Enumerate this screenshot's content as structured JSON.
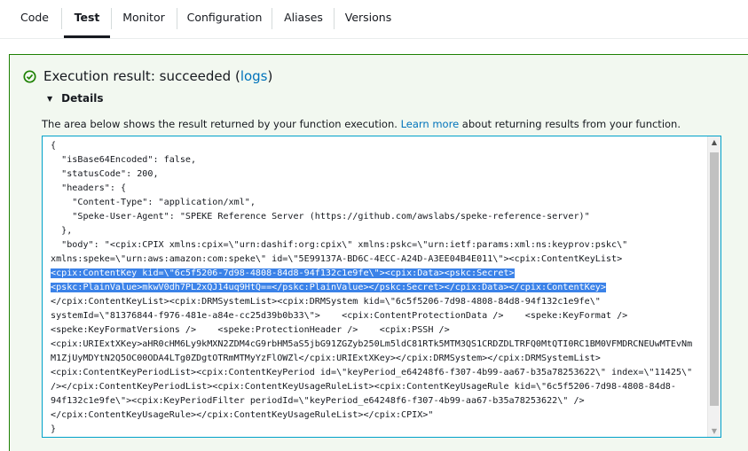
{
  "tabs": [
    {
      "label": "Code",
      "active": false
    },
    {
      "label": "Test",
      "active": true
    },
    {
      "label": "Monitor",
      "active": false
    },
    {
      "label": "Configuration",
      "active": false
    },
    {
      "label": "Aliases",
      "active": false
    },
    {
      "label": "Versions",
      "active": false
    }
  ],
  "result": {
    "status_prefix": "Execution result: succeeded (",
    "logs_link": "logs",
    "status_suffix": ")",
    "status_icon": "check-circle-icon",
    "status_color": "#1d8102"
  },
  "details": {
    "label": "Details",
    "icon": "triangle-down-icon",
    "description_before": "The area below shows the result returned by your function execution. ",
    "learn_more": "Learn more",
    "description_after": " about returning results from your function."
  },
  "output": {
    "lines": [
      "{",
      "  \"isBase64Encoded\": false,",
      "  \"statusCode\": 200,",
      "  \"headers\": {",
      "    \"Content-Type\": \"application/xml\",",
      "    \"Speke-User-Agent\": \"SPEKE Reference Server (https://github.com/awslabs/speke-reference-server)\"",
      "  },",
      "  \"body\": \"<cpix:CPIX xmlns:cpix=\\\"urn:dashif:org:cpix\\\" xmlns:pskc=\\\"urn:ietf:params:xml:ns:keyprov:pskc\\\"",
      "xmlns:speke=\\\"urn:aws:amazon:com:speke\\\" id=\\\"5E99137A-BD6C-4ECC-A24D-A3EE04B4E011\\\"><cpix:ContentKeyList>",
      "<cpix:ContentKey kid=\\\"6c5f5206-7d98-4808-84d8-94f132c1e9fe\\\"><cpix:Data><pskc:Secret>",
      "<pskc:PlainValue>mkwV0dh7PL2xQJ14uq9HtQ==</pskc:PlainValue></pskc:Secret></cpix:Data></cpix:ContentKey>",
      "</cpix:ContentKeyList><cpix:DRMSystemList><cpix:DRMSystem kid=\\\"6c5f5206-7d98-4808-84d8-94f132c1e9fe\\\"",
      "systemId=\\\"81376844-f976-481e-a84e-cc25d39b0b33\\\">    <cpix:ContentProtectionData />    <speke:KeyFormat />",
      "<speke:KeyFormatVersions />    <speke:ProtectionHeader />    <cpix:PSSH />",
      "<cpix:URIExtXKey>aHR0cHM6Ly9kMXN2ZDM4cG9rbHM5aS5jbG91ZGZyb250Lm5ldC81RTk5MTM3QS1CRDZDLTRFQ0MtQTI0RC1BM0VFMDRCNEUwMTEvNm",
      "M1ZjUyMDYtN2Q5OC00ODA4LTg0ZDgtOTRmMTMyYzFlOWZl</cpix:URIExtXKey></cpix:DRMSystem></cpix:DRMSystemList>",
      "<cpix:ContentKeyPeriodList><cpix:ContentKeyPeriod id=\\\"keyPeriod_e64248f6-f307-4b99-aa67-b35a78253622\\\" index=\\\"11425\\\"",
      "/></cpix:ContentKeyPeriodList><cpix:ContentKeyUsageRuleList><cpix:ContentKeyUsageRule kid=\\\"6c5f5206-7d98-4808-84d8-",
      "94f132c1e9fe\\\"><cpix:KeyPeriodFilter periodId=\\\"keyPeriod_e64248f6-f307-4b99-aa67-b35a78253622\\\" />",
      "</cpix:ContentKeyUsageRule></cpix:ContentKeyUsageRuleList></cpix:CPIX>\"",
      "}"
    ],
    "highlighted_lines": [
      9,
      10
    ],
    "highlight_color": "#3b82e8"
  },
  "scrollbar": {
    "up_icon": "scroll-up-arrow-icon",
    "down_icon": "scroll-down-arrow-icon"
  }
}
